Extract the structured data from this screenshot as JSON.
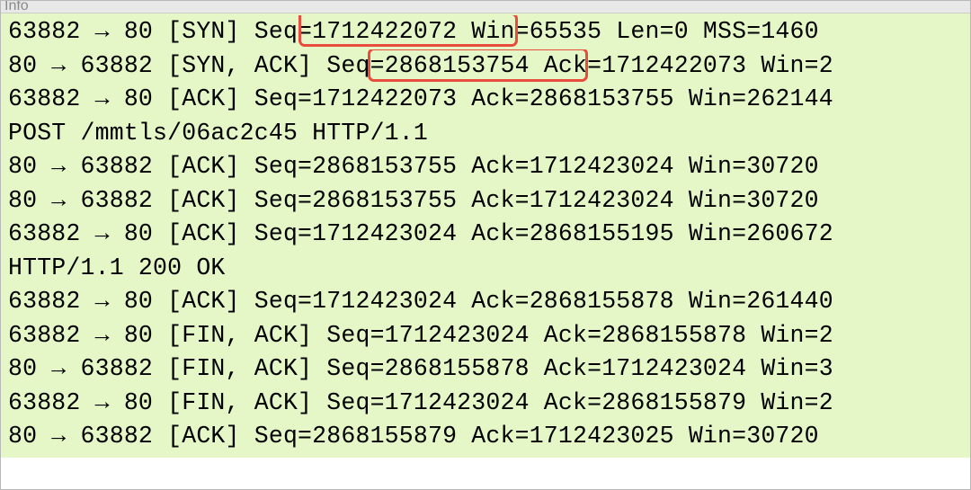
{
  "header": {
    "title": "Info"
  },
  "rows": [
    {
      "text": "63882 → 80  [SYN]  Seq=1712422072  Win=65535  Len=0  MSS=1460 "
    },
    {
      "text": "80 → 63882  [SYN, ACK]  Seq=2868153754  Ack=1712422073 Win=2"
    },
    {
      "text": "63882 → 80  [ACK]  Seq=1712422073  Ack=2868153755 Win=262144"
    },
    {
      "text": "POST /mmtls/06ac2c45 HTTP/1.1"
    },
    {
      "text": "80 → 63882  [ACK]  Seq=2868153755  Ack=1712423024 Win=30720 "
    },
    {
      "text": "80 → 63882  [ACK]  Seq=2868153755  Ack=1712423024 Win=30720 "
    },
    {
      "text": "63882 → 80  [ACK]  Seq=1712423024  Ack=2868155195 Win=260672"
    },
    {
      "text": "HTTP/1.1 200 OK"
    },
    {
      "text": "63882 → 80  [ACK]  Seq=1712423024  Ack=2868155878 Win=261440"
    },
    {
      "text": "63882 → 80  [FIN, ACK]  Seq=1712423024  Ack=2868155878 Win=2"
    },
    {
      "text": "80 → 63882  [FIN, ACK]  Seq=2868155878  Ack=1712423024 Win=3"
    },
    {
      "text": "63882 → 80  [FIN, ACK]  Seq=1712423024  Ack=2868155879 Win=2"
    },
    {
      "text": "80 → 63882  [ACK]  Seq=2868155879  Ack=1712423025 Win=30720 "
    }
  ],
  "highlights": [
    {
      "row_index": 0,
      "segment": "Seq=1712422072"
    },
    {
      "row_index": 1,
      "segment": "Seq=2868153754"
    }
  ]
}
